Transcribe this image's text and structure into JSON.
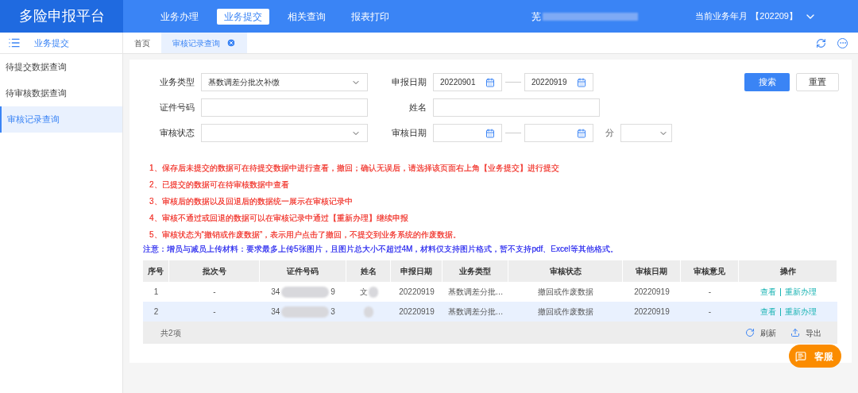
{
  "header": {
    "title": "多险申报平台",
    "nav": [
      {
        "label": "业务办理",
        "selected": false
      },
      {
        "label": "业务提交",
        "selected": true
      },
      {
        "label": "相关查询",
        "selected": false
      },
      {
        "label": "报表打印",
        "selected": false
      }
    ],
    "user": "芜",
    "period_label": "当前业务年月",
    "period": "【202209】"
  },
  "sidebar": {
    "title": "业务提交",
    "items": [
      {
        "label": "待提交数据查询",
        "selected": false
      },
      {
        "label": "待审核数据查询",
        "selected": false
      },
      {
        "label": "审核记录查询",
        "selected": true
      }
    ]
  },
  "tabs": [
    {
      "label": "首页",
      "selected": false,
      "closable": false
    },
    {
      "label": "审核记录查询",
      "selected": true,
      "closable": true
    }
  ],
  "form": {
    "business_type": {
      "label": "业务类型",
      "value": "基数调差分批次补缴"
    },
    "report_date": {
      "label": "申报日期",
      "from": "20220901",
      "to": "20220919"
    },
    "id_number": {
      "label": "证件号码"
    },
    "name": {
      "label": "姓名"
    },
    "review_status": {
      "label": "审核状态"
    },
    "review_date": {
      "label": "审核日期"
    },
    "unit_label": "分",
    "search_button": "搜索",
    "reset_button": "重置"
  },
  "notes": [
    {
      "text": "1、保存后未提交的数据可在待提交数据中进行查看，撤回；确认无误后，请选择该页面右上角【业务提交】进行提交",
      "color": "#f2453d"
    },
    {
      "text": "2、已提交的数据可在待审核数据中查看",
      "color": "#f2453d"
    },
    {
      "text": "3、审核后的数据以及回退后的数据统一展示在审核记录中",
      "color": "#f2453d"
    },
    {
      "text": "4、审核不通过或回退的数据可以在审核记录中通过【重新办理】继续申报",
      "color": "#f2453d"
    },
    {
      "text": "5、审核状态为“撤销或作废数据”，表示用户点击了撤回，不提交到业务系统的作废数据。",
      "color": "#f2453d"
    },
    {
      "text": "注意：增员与减员上传材料：要求最多上传5张图片，且图片总大小不超过4M，材料仅支持图片格式，暂不支持pdf、Excel等其他格式。",
      "color": "#3b3bf0"
    }
  ],
  "table": {
    "columns": [
      "序号",
      "批次号",
      "证件号码",
      "姓名",
      "申报日期",
      "业务类型",
      "审核状态",
      "审核日期",
      "审核意见",
      "操作"
    ],
    "rows": [
      {
        "selected": false,
        "index": "1",
        "batch": "-",
        "id_start": "34",
        "id_end": "9",
        "name": "文",
        "report_date": "20220919",
        "type": "基数调差分批…",
        "status": "撤回或作废数据",
        "review_date": "20220919",
        "opinion": "-",
        "actions": [
          "查看",
          "重新办理"
        ]
      },
      {
        "selected": true,
        "index": "2",
        "batch": "-",
        "id_start": "34",
        "id_end": "3",
        "report_date": "20220919",
        "type": "基数调差分批…",
        "status": "撤回或作废数据",
        "review_date": "20220919",
        "opinion": "-",
        "actions": [
          "查看",
          "重新办理"
        ]
      }
    ],
    "total": "共2项",
    "refresh": "刷新",
    "export": "导出"
  },
  "service_button": "客服"
}
